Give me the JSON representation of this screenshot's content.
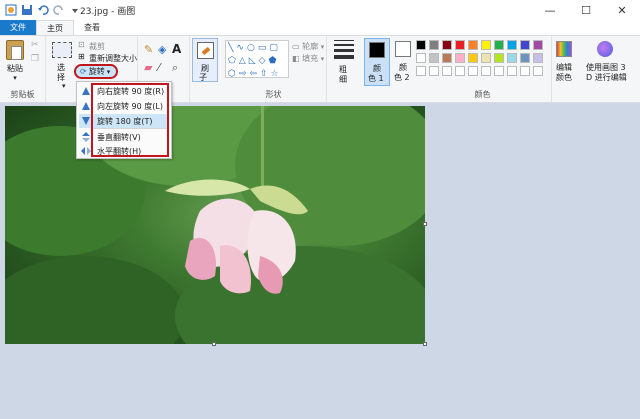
{
  "window": {
    "title": "23.jpg - 画图",
    "minimize": "—",
    "maximize": "☐",
    "close": "✕"
  },
  "tabs": [
    {
      "label": "文件"
    },
    {
      "label": "主页"
    },
    {
      "label": "查看"
    }
  ],
  "clipboard": {
    "paste_label": "粘贴",
    "group_label": "剪贴板"
  },
  "image": {
    "select_label": "选",
    "select_label2": "择",
    "crop_label": "裁剪",
    "resize_label": "重新调整大小",
    "rotate_label": "旋转"
  },
  "tools": {
    "brush_label": "刷",
    "brush_label2": "子"
  },
  "shapes": {
    "outline_label": "轮廓",
    "fill_label": "填充",
    "group_label": "形状"
  },
  "thickness_label": "粗",
  "thickness_label2": "细",
  "colors": {
    "color1_label": "颜",
    "color1_label2": "色 1",
    "color2_label": "颜",
    "color2_label2": "色 2",
    "edit_colors_label": "编辑",
    "edit_colors_label2": "颜色",
    "paint3d_label": "使用画图 3",
    "paint3d_label2": "D 进行编辑",
    "group_label": "颜色",
    "color1": "#000000",
    "color2": "#ffffff",
    "palette": [
      "#000000",
      "#7f7f7f",
      "#880015",
      "#ed1c24",
      "#ff7f27",
      "#fff200",
      "#22b14c",
      "#00a2e8",
      "#3f48cc",
      "#a349a4",
      "#ffffff",
      "#c3c3c3",
      "#b97a57",
      "#ffaec9",
      "#ffc90e",
      "#efe4b0",
      "#b5e61d",
      "#99d9ea",
      "#7092be",
      "#c8bfe7",
      "#ffffff",
      "#ffffff",
      "#ffffff",
      "#ffffff",
      "#ffffff",
      "#ffffff",
      "#ffffff",
      "#ffffff",
      "#ffffff",
      "#ffffff"
    ]
  },
  "rotate_menu": [
    {
      "label": "向右旋转 90 度(R)",
      "icon": "rotate-right-icon"
    },
    {
      "label": "向左旋转 90 度(L)",
      "icon": "rotate-left-icon"
    },
    {
      "label": "旋转 180 度(T)",
      "icon": "rotate-180-icon"
    },
    {
      "label": "垂直翻转(V)",
      "icon": "flip-vertical-icon"
    },
    {
      "label": "水平翻转(H)",
      "icon": "flip-horizontal-icon"
    }
  ],
  "accent": "#c0161e"
}
